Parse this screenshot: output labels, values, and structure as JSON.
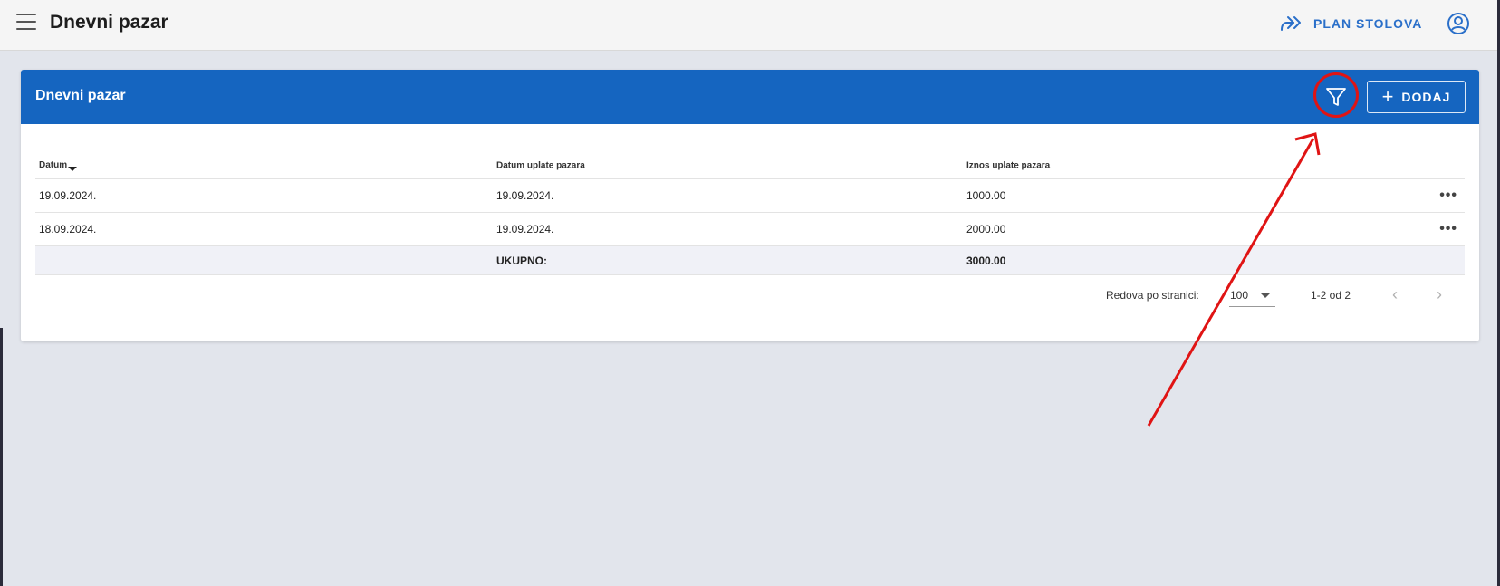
{
  "header": {
    "title": "Dnevni pazar",
    "plan_label": "PLAN STOLOVA"
  },
  "icons": {
    "menu": "menu-icon",
    "plan": "forward-arrows-icon",
    "user": "user-circle-icon",
    "filter": "filter-icon",
    "add": "plus-icon",
    "more": "more-horizontal-icon"
  },
  "card": {
    "title": "Dnevni pazar",
    "add_label": "DODAJ"
  },
  "table": {
    "columns": [
      "Datum",
      "Datum uplate pazara",
      "Iznos uplate pazara"
    ],
    "rows": [
      [
        "19.09.2024.",
        "19.09.2024.",
        "1000.00"
      ],
      [
        "18.09.2024.",
        "19.09.2024.",
        "2000.00"
      ]
    ],
    "total_label": "UKUPNO:",
    "total_value": "3000.00"
  },
  "pager": {
    "rows_per_page_label": "Redova po stranici:",
    "rows_per_page": "100",
    "range": "1-2 od 2"
  },
  "colors": {
    "header_blue": "#1565c0",
    "accent_blue": "#2a6fc9",
    "annotation_red": "#e01414"
  }
}
